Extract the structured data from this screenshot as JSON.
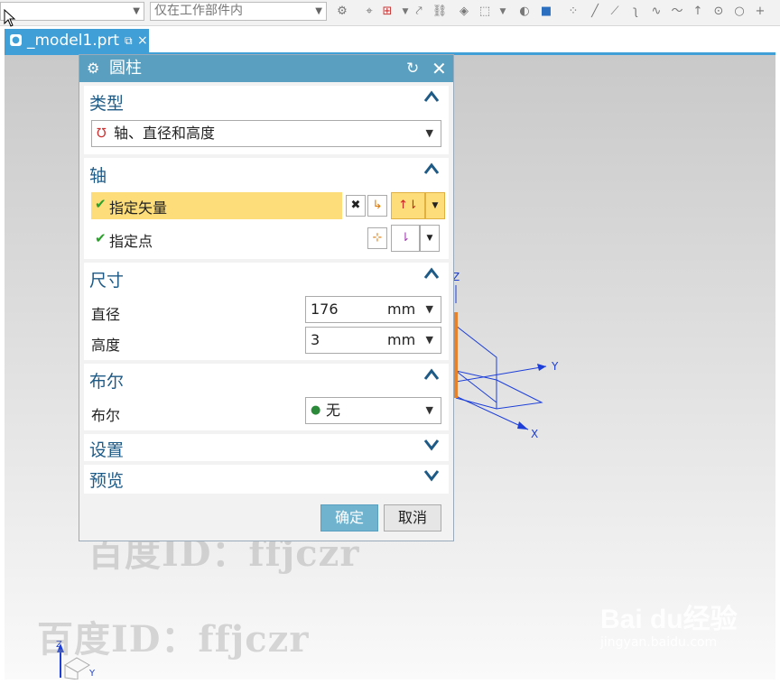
{
  "toolbar": {
    "filter_select": "仅在工作部件内",
    "arrow": "▼"
  },
  "document_tab": {
    "label": "_model1.prt",
    "pin": "⧉",
    "close": "×"
  },
  "dialog": {
    "title": "圆柱",
    "type_section": {
      "heading": "类型",
      "selected": "轴、直径和高度"
    },
    "axis_section": {
      "heading": "轴",
      "specify_vector": "指定矢量",
      "specify_point": "指定点"
    },
    "dimensions_section": {
      "heading": "尺寸",
      "diameter_label": "直径",
      "diameter_value": "176",
      "diameter_unit": "mm",
      "height_label": "高度",
      "height_value": "3",
      "height_unit": "mm"
    },
    "boolean_section": {
      "heading": "布尔",
      "label": "布尔",
      "selected": "无"
    },
    "settings_section": {
      "heading": "设置"
    },
    "preview_section": {
      "heading": "预览"
    },
    "ok_label": "确定",
    "cancel_label": "取消"
  },
  "viewport": {
    "axis_labels": {
      "x": "X",
      "y": "Y",
      "z": "Z"
    },
    "watermark_text": "百度ID：ffjczr",
    "baidu_logo": "Bai du经验",
    "baidu_url": "jingyan.baidu.com"
  },
  "colors": {
    "tab_blue": "#3f9fd6",
    "dialog_title": "#5a9fc0",
    "highlight_row": "#fddc7a",
    "ok_button": "#6fb3cf",
    "section_heading": "#1e5a86"
  }
}
